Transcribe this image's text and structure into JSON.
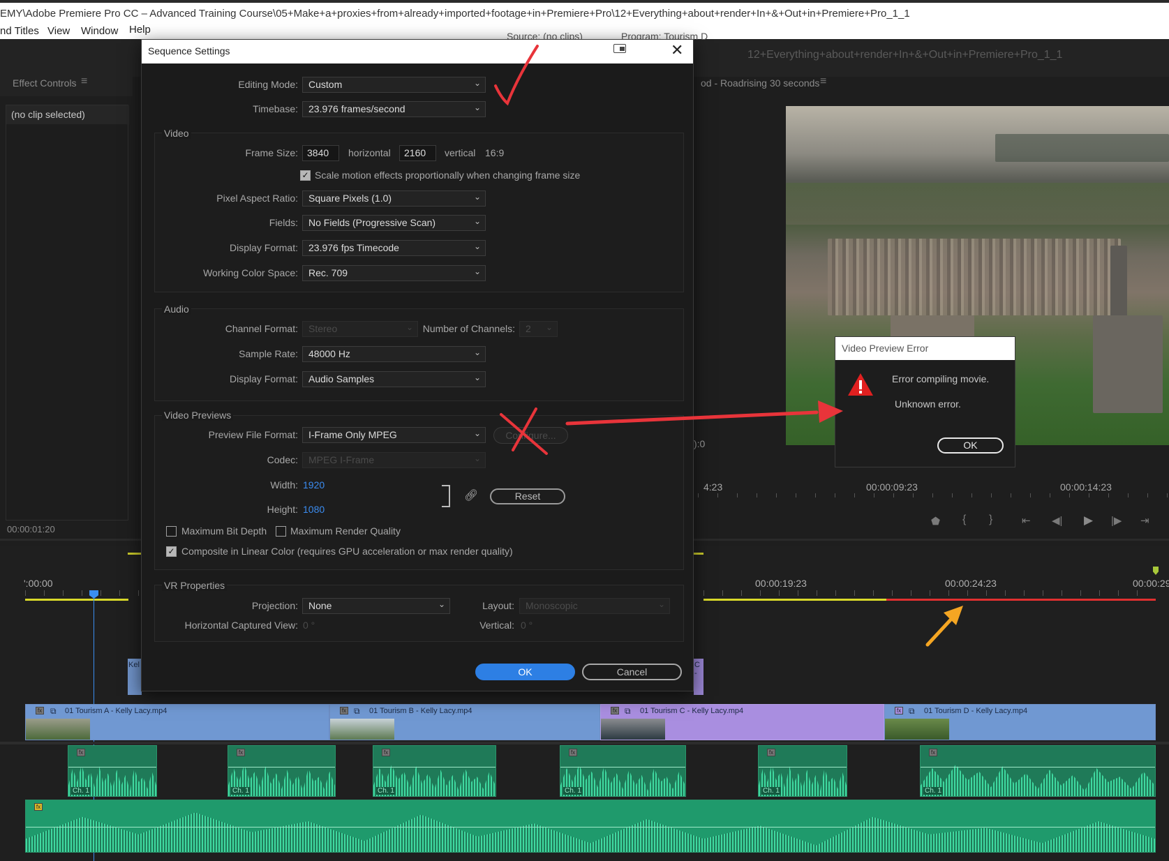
{
  "window": {
    "title": "EMY\\Adobe Premiere Pro CC – Advanced Training Course\\05+Make+a+proxies+from+already+imported+footage+in+Premiere+Pro\\12+Everything+about+render+In+&+Out+in+Premiere+Pro_1_1",
    "menu": [
      "nd Titles",
      "View",
      "Window",
      "Help"
    ]
  },
  "panels": {
    "effect_controls_tab": "Effect Controls",
    "no_clip": "(no clip selected)",
    "timecode": "00:00:01:20",
    "source_tab": "Source: (no clips)",
    "program_tab": "Program: Tourism D",
    "sequence_title": "12+Everything+about+render+In+&+Out+in+Premiere+Pro_1_1",
    "sequence_tab": "od - Roadrising 30 seconds",
    "program_times": [
      "4:23",
      "00:00:09:23",
      "00:00:14:23"
    ],
    "program_edge": "):0"
  },
  "timeline": {
    "ruler": [
      "':00:00",
      "00:00:19:23",
      "00:00:24:23",
      "00:00:29"
    ],
    "clips": [
      {
        "name": "01 Tourism A - Kelly Lacy.mp4"
      },
      {
        "name": "01 Tourism B - Kelly Lacy.mp4"
      },
      {
        "name": "01 Tourism C - Kelly Lacy.mp4"
      },
      {
        "name": "01 Tourism D - Kelly Lacy.mp4"
      }
    ],
    "channel_label": "Ch. 1",
    "fx_label": "fx",
    "clip_peek": "Kel",
    "clip_peek_right": "C -"
  },
  "dialog": {
    "title": "Sequence Settings",
    "editing_mode": {
      "label": "Editing Mode:",
      "value": "Custom"
    },
    "timebase": {
      "label": "Timebase:",
      "value": "23.976  frames/second"
    },
    "video": {
      "section": "Video",
      "frame_size_label": "Frame Size:",
      "frame_width": "3840",
      "horizontal": "horizontal",
      "frame_height": "2160",
      "vertical": "vertical",
      "aspect": "16:9",
      "scale_motion": "Scale motion effects proportionally when changing frame size",
      "pixel_aspect": {
        "label": "Pixel Aspect Ratio:",
        "value": "Square Pixels (1.0)"
      },
      "fields": {
        "label": "Fields:",
        "value": "No Fields (Progressive Scan)"
      },
      "display_format": {
        "label": "Display Format:",
        "value": "23.976 fps Timecode"
      },
      "color_space": {
        "label": "Working Color Space:",
        "value": "Rec. 709"
      }
    },
    "audio": {
      "section": "Audio",
      "channel_format": {
        "label": "Channel Format:",
        "value": "Stereo"
      },
      "num_channels": {
        "label": "Number of Channels:",
        "value": "2"
      },
      "sample_rate": {
        "label": "Sample Rate:",
        "value": "48000 Hz"
      },
      "display_format": {
        "label": "Display Format:",
        "value": "Audio Samples"
      }
    },
    "previews": {
      "section": "Video Previews",
      "file_format": {
        "label": "Preview File Format:",
        "value": "I-Frame Only MPEG"
      },
      "configure": "Configure...",
      "codec": {
        "label": "Codec:",
        "value": "MPEG I-Frame"
      },
      "width": {
        "label": "Width:",
        "value": "1920"
      },
      "height": {
        "label": "Height:",
        "value": "1080"
      },
      "reset": "Reset",
      "max_bit_depth": "Maximum Bit Depth",
      "max_render_quality": "Maximum Render Quality",
      "linear_color": "Composite in Linear Color (requires GPU acceleration or max render quality)"
    },
    "vr": {
      "section": "VR Properties",
      "projection": {
        "label": "Projection:",
        "value": "None"
      },
      "layout": {
        "label": "Layout:",
        "value": "Monoscopic"
      },
      "h_view": {
        "label": "Horizontal Captured View:",
        "value": "0 °"
      },
      "vertical": {
        "label": "Vertical:",
        "value": "0 °"
      }
    },
    "ok": "OK",
    "cancel": "Cancel"
  },
  "error": {
    "title": "Video Preview Error",
    "message": "Error compiling movie.",
    "detail": "Unknown error.",
    "ok": "OK"
  },
  "colors": {
    "accent": "#2d7fe4",
    "annotation_red": "#e8343a",
    "annotation_orange": "#f5a623"
  }
}
